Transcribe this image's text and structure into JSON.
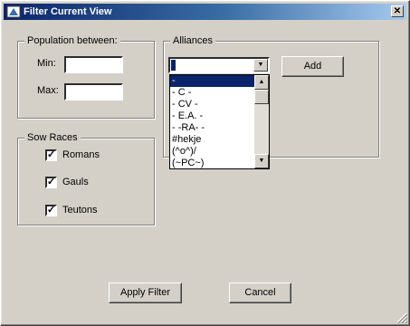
{
  "window": {
    "title": "Filter Current View",
    "close_glyph": "✕"
  },
  "population": {
    "legend": "Population between:",
    "min_label": "Min:",
    "min_value": "",
    "max_label": "Max:",
    "max_value": ""
  },
  "races": {
    "legend": "Sow Races",
    "items": [
      {
        "label": "Romans",
        "checked": true
      },
      {
        "label": "Gauls",
        "checked": true
      },
      {
        "label": "Teutons",
        "checked": true
      }
    ]
  },
  "alliances": {
    "legend": "Alliances",
    "combo_value": "",
    "add_label": "Add",
    "options": [
      "-",
      "- C -",
      "- CV -",
      "- E.A. -",
      "- -RA- -",
      "#hekje",
      "(^o^)/",
      "(~PC~)"
    ],
    "selected_index": 0
  },
  "buttons": {
    "apply": "Apply Filter",
    "cancel": "Cancel"
  },
  "colors": {
    "title_start": "#0a246a",
    "title_end": "#a6caf0",
    "face": "#d4d0c8",
    "highlight": "#0a246a"
  },
  "icons": {
    "app": "app-icon",
    "close": "close-icon",
    "check": "check-icon",
    "dropdown": "chevron-down-icon",
    "grip": "resize-grip-icon"
  }
}
